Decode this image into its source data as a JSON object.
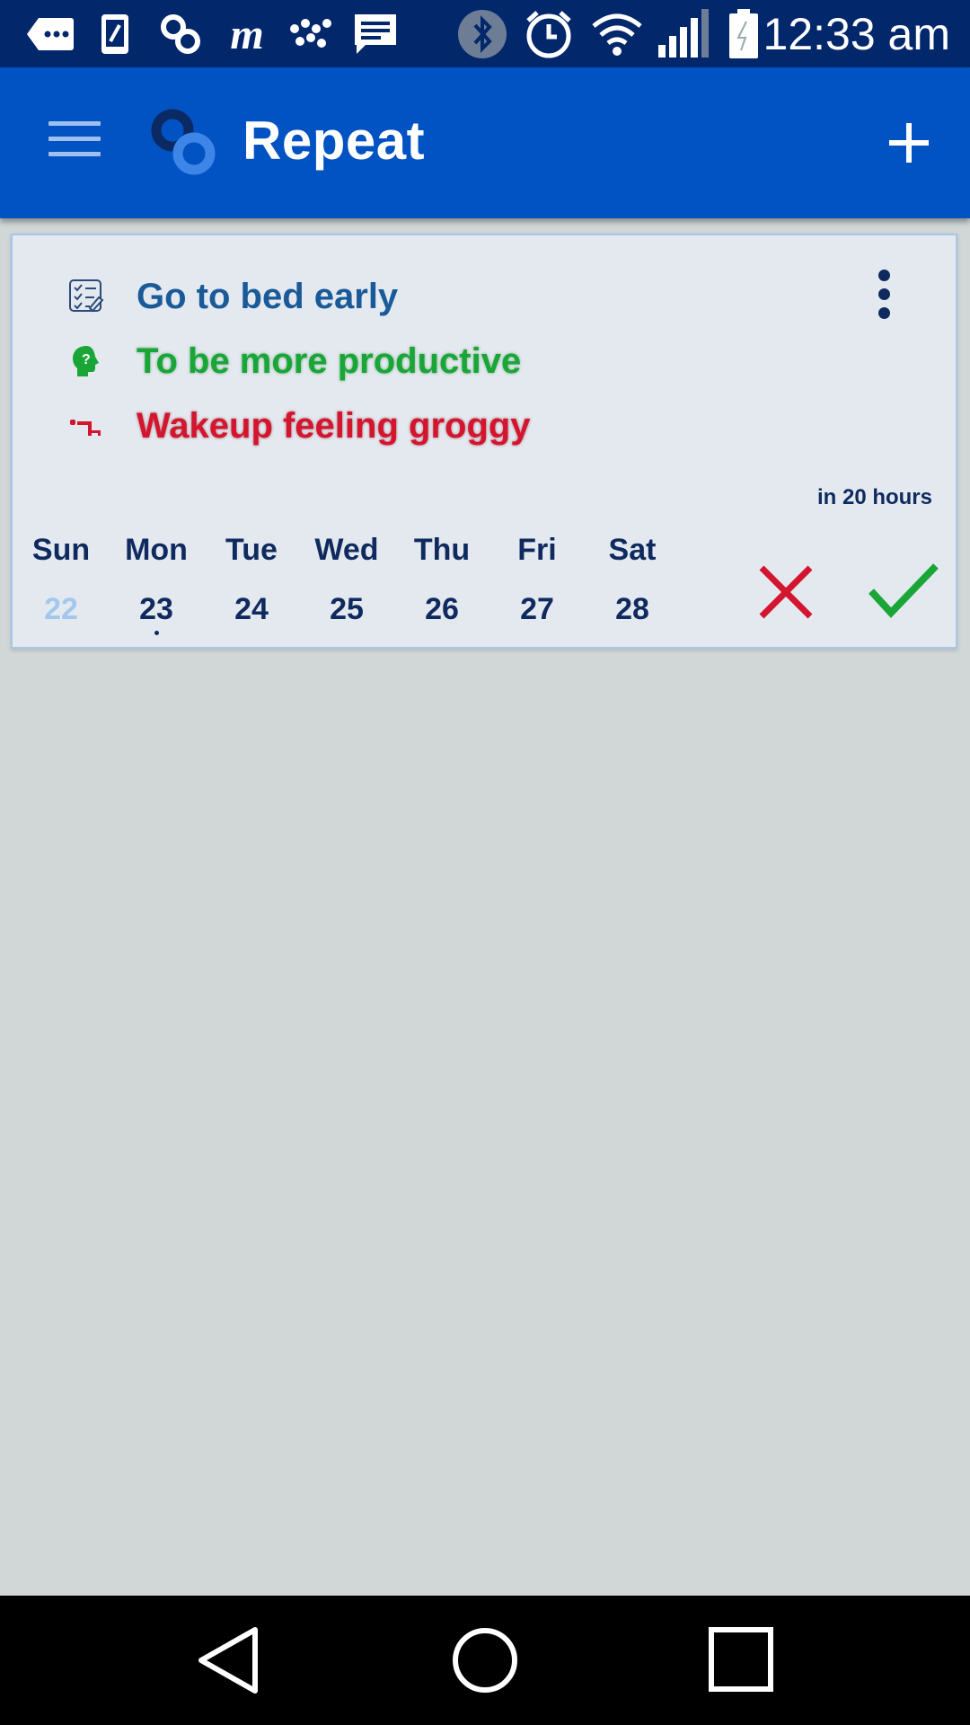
{
  "status_bar": {
    "left_icons": [
      "tag-icon",
      "phone-icon",
      "link-icon",
      "m-app-icon",
      "dots-app-icon",
      "message-icon"
    ],
    "right_icons": [
      "bluetooth-icon",
      "alarm-icon",
      "wifi-icon",
      "signal-icon",
      "battery-icon"
    ],
    "time": "12:33 am"
  },
  "app_bar": {
    "title": "Repeat",
    "menu_icon": "menu-icon",
    "logo_icon": "repeat-logo-icon",
    "add_icon": "plus-icon"
  },
  "habit_card": {
    "habit": "Go to bed early",
    "benefit": "To be more productive",
    "cost": "Wakeup feeling groggy",
    "due": "in 20 hours",
    "week": [
      {
        "name": "Sun",
        "date": "22",
        "state": "past"
      },
      {
        "name": "Mon",
        "date": "23",
        "state": "today"
      },
      {
        "name": "Tue",
        "date": "24",
        "state": "future"
      },
      {
        "name": "Wed",
        "date": "25",
        "state": "future"
      },
      {
        "name": "Thu",
        "date": "26",
        "state": "future"
      },
      {
        "name": "Fri",
        "date": "27",
        "state": "future"
      },
      {
        "name": "Sat",
        "date": "28",
        "state": "future"
      }
    ],
    "fail_icon": "x-icon",
    "done_icon": "check-icon"
  },
  "nav_bar": {
    "icons": [
      "back-icon",
      "home-icon",
      "recents-icon"
    ]
  },
  "colors": {
    "status_bar": "#03276b",
    "app_bar": "#0152c2",
    "background": "#d1d6d7",
    "card": "#e4e9f0",
    "habit_text": "#1a5a98",
    "benefit_text": "#19a637",
    "cost_text": "#d3162e",
    "accent_dark": "#0f2a5e"
  }
}
